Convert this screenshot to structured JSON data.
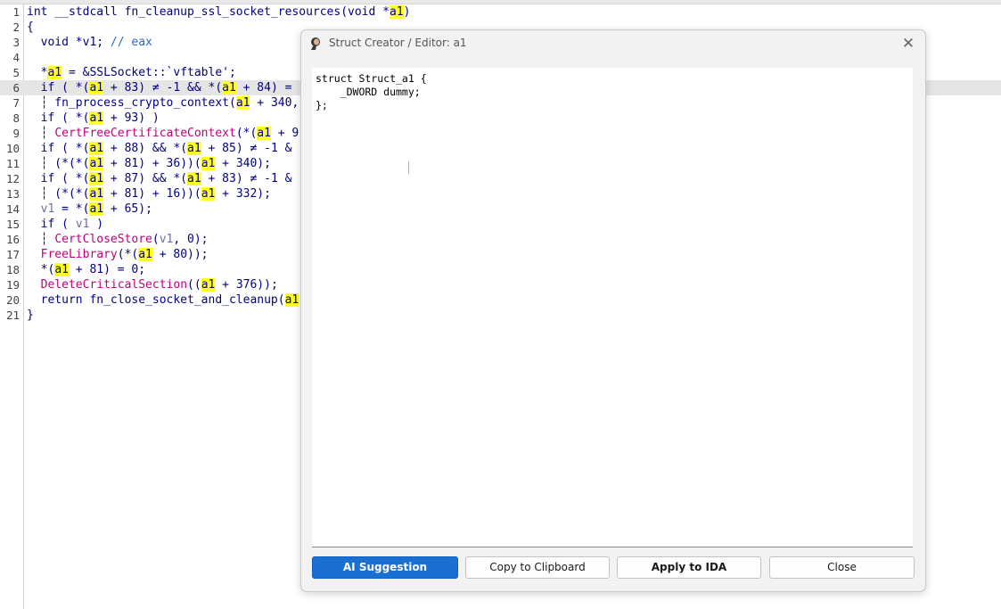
{
  "code_lines": [
    {
      "num": "1",
      "html": "int __stdcall fn_cleanup_ssl_socket_resources(void *<span class=\"hl\">a1</span>)"
    },
    {
      "num": "2",
      "html": "{"
    },
    {
      "num": "3",
      "html": "  void *v1; <span class=\"cm\">// eax</span>"
    },
    {
      "num": "4",
      "html": ""
    },
    {
      "num": "5",
      "html": "  *<span class=\"hl\">a1</span> = &SSLSocket::`vftable';"
    },
    {
      "num": "6",
      "html": "  if ( *(<span class=\"hl\">a1</span> + 83) ≠ -1 && *(<span class=\"hl\">a1</span> + 84) ="
    },
    {
      "num": "7",
      "html": "  ┆ fn_process_crypto_context(<span class=\"hl\">a1</span> + 340,"
    },
    {
      "num": "8",
      "html": "  if ( *(<span class=\"hl\">a1</span> + 93) )"
    },
    {
      "num": "9",
      "html": "  ┆ <span class=\"fn\">CertFreeCertificateContext</span>(*(<span class=\"hl\">a1</span> + 9"
    },
    {
      "num": "10",
      "html": "  if ( *(<span class=\"hl\">a1</span> + 88) && *(<span class=\"hl\">a1</span> + 85) ≠ -1 &"
    },
    {
      "num": "11",
      "html": "  ┆ (*(*(<span class=\"hl\">a1</span> + 81) + 36))(<span class=\"hl\">a1</span> + 340);"
    },
    {
      "num": "12",
      "html": "  if ( *(<span class=\"hl\">a1</span> + 87) && *(<span class=\"hl\">a1</span> + 83) ≠ -1 &"
    },
    {
      "num": "13",
      "html": "  ┆ (*(*(<span class=\"hl\">a1</span> + 81) + 16))(<span class=\"hl\">a1</span> + 332);"
    },
    {
      "num": "14",
      "html": "  <span class=\"gv\">v1</span> = *(<span class=\"hl\">a1</span> + 65);"
    },
    {
      "num": "15",
      "html": "  if ( <span class=\"gv\">v1</span> )"
    },
    {
      "num": "16",
      "html": "  ┆ <span class=\"fn\">CertCloseStore</span>(<span class=\"gv\">v1</span>, 0);"
    },
    {
      "num": "17",
      "html": "  <span class=\"fn\">FreeLibrary</span>(*(<span class=\"hl\">a1</span> + 80));"
    },
    {
      "num": "18",
      "html": "  *(<span class=\"hl\">a1</span> + 81) = 0;"
    },
    {
      "num": "19",
      "html": "  <span class=\"fn\">DeleteCriticalSection</span>((<span class=\"hl\">a1</span> + 376));"
    },
    {
      "num": "20",
      "html": "  return fn_close_socket_and_cleanup(<span class=\"hl\">a1</span>"
    },
    {
      "num": "21",
      "html": "}"
    }
  ],
  "current_line": 6,
  "dialog": {
    "title": "Struct Creator / Editor: a1",
    "close_glyph": "✕",
    "struct_text": "struct Struct_a1 {\n    _DWORD dummy;\n};",
    "buttons": {
      "ai": "AI Suggestion",
      "copy": "Copy to Clipboard",
      "apply": "Apply to IDA",
      "close": "Close"
    }
  },
  "colors": {
    "highlight": "#ffff2a",
    "accent": "#1a6fd1",
    "keyword": "#000080",
    "function": "#c0007a",
    "comment": "#2b67c6"
  }
}
